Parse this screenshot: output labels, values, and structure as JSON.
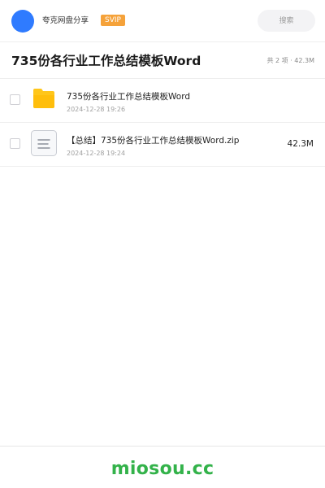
{
  "header": {
    "username": "夸克网盘分享",
    "badge": "SVIP",
    "search_placeholder": "搜索"
  },
  "folder": {
    "title": "735份各行业工作总结模板Word",
    "summary": "共 2 项 · 42.3M"
  },
  "files": [
    {
      "name": "735份各行业工作总结模板Word",
      "date": "2024-12-28 19:26",
      "size": "",
      "icon": "folder-icon"
    },
    {
      "name": "【总结】735份各行业工作总结模板Word.zip",
      "date": "2024-12-28 19:24",
      "size": "42.3M",
      "icon": "document-icon"
    }
  ],
  "footer": {
    "brand": "miosou.cc"
  },
  "colors": {
    "avatar": "#2f7bff",
    "badge": "#f5a23a",
    "folder": "#ffc61a",
    "brand": "#33b24a"
  }
}
